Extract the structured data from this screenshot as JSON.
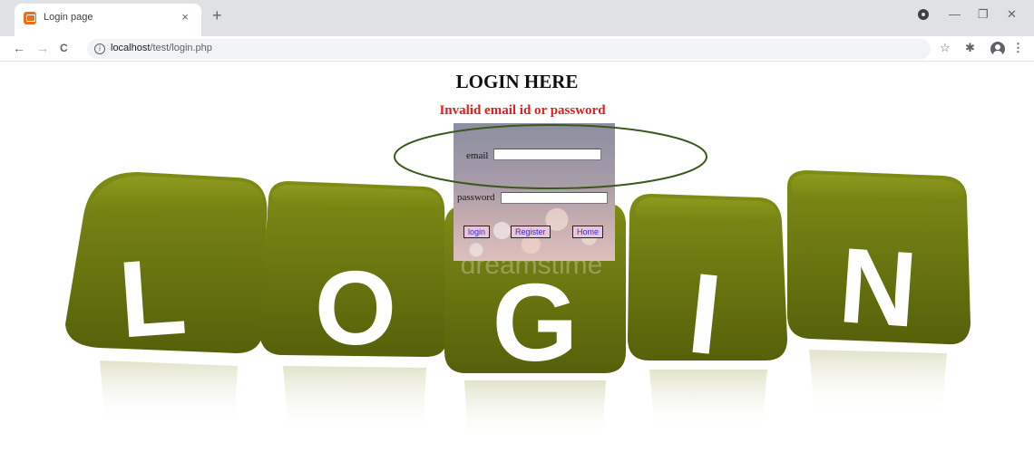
{
  "browser": {
    "tab_title": "Login page",
    "tab_close": "×",
    "new_tab": "+",
    "url_host": "localhost",
    "url_path": "/test/login.php",
    "nav_back": "←",
    "nav_forward": "→",
    "nav_reload": "C",
    "info": "i",
    "star": "☆",
    "extensions": "✱",
    "menu": "⋮",
    "minimize": "—",
    "restore": "❐",
    "close": "✕"
  },
  "page": {
    "title": "LOGIN HERE",
    "error": "Invalid email id or password",
    "form": {
      "email_label": "email",
      "email_value": "",
      "password_label": "password",
      "password_value": "",
      "buttons": {
        "login": "login",
        "register": "Register",
        "home": "Home"
      }
    },
    "background_letters": [
      "L",
      "O",
      "G",
      "I",
      "N"
    ],
    "watermark": "dreamstime"
  },
  "colors": {
    "cube": "#6d7a10",
    "error": "#e31b1b",
    "ellipse": "#3a5a1c"
  }
}
